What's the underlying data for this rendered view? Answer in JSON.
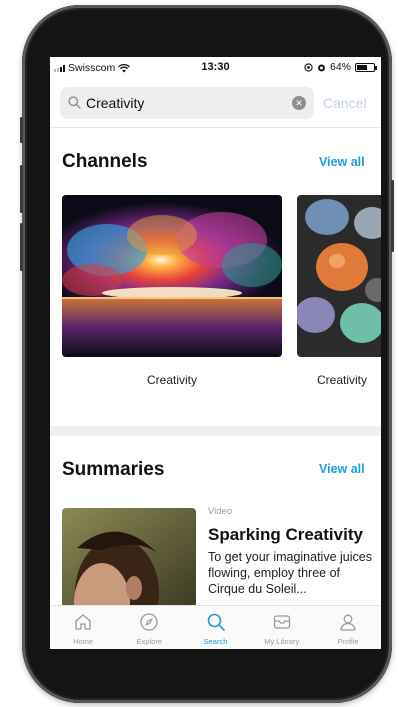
{
  "status_bar": {
    "carrier": "Swisscom",
    "time": "13:30",
    "battery": "64%",
    "battery_level": 0.64
  },
  "search": {
    "query": "Creativity",
    "cancel_label": "Cancel"
  },
  "channels": {
    "title": "Channels",
    "view_all": "View all",
    "items": [
      {
        "label": "Creativity"
      },
      {
        "label": "Creativity"
      }
    ]
  },
  "summaries": {
    "title": "Summaries",
    "view_all": "View all",
    "items": [
      {
        "kicker": "Video",
        "title": "Sparking Creativity",
        "description": "To get your imaginative juices flowing, employ three of Cirque du Soleil..."
      }
    ]
  },
  "tabbar": {
    "tabs": [
      {
        "label": "Home",
        "icon": "home-icon"
      },
      {
        "label": "Explore",
        "icon": "compass-icon"
      },
      {
        "label": "Search",
        "icon": "search-icon"
      },
      {
        "label": "My Library",
        "icon": "library-icon"
      },
      {
        "label": "Profile",
        "icon": "profile-icon"
      }
    ],
    "active": "Search"
  },
  "colors": {
    "accent": "#1aa0d8",
    "cancel_disabled": "#c7d3e3",
    "phone_frame": "#141414"
  }
}
